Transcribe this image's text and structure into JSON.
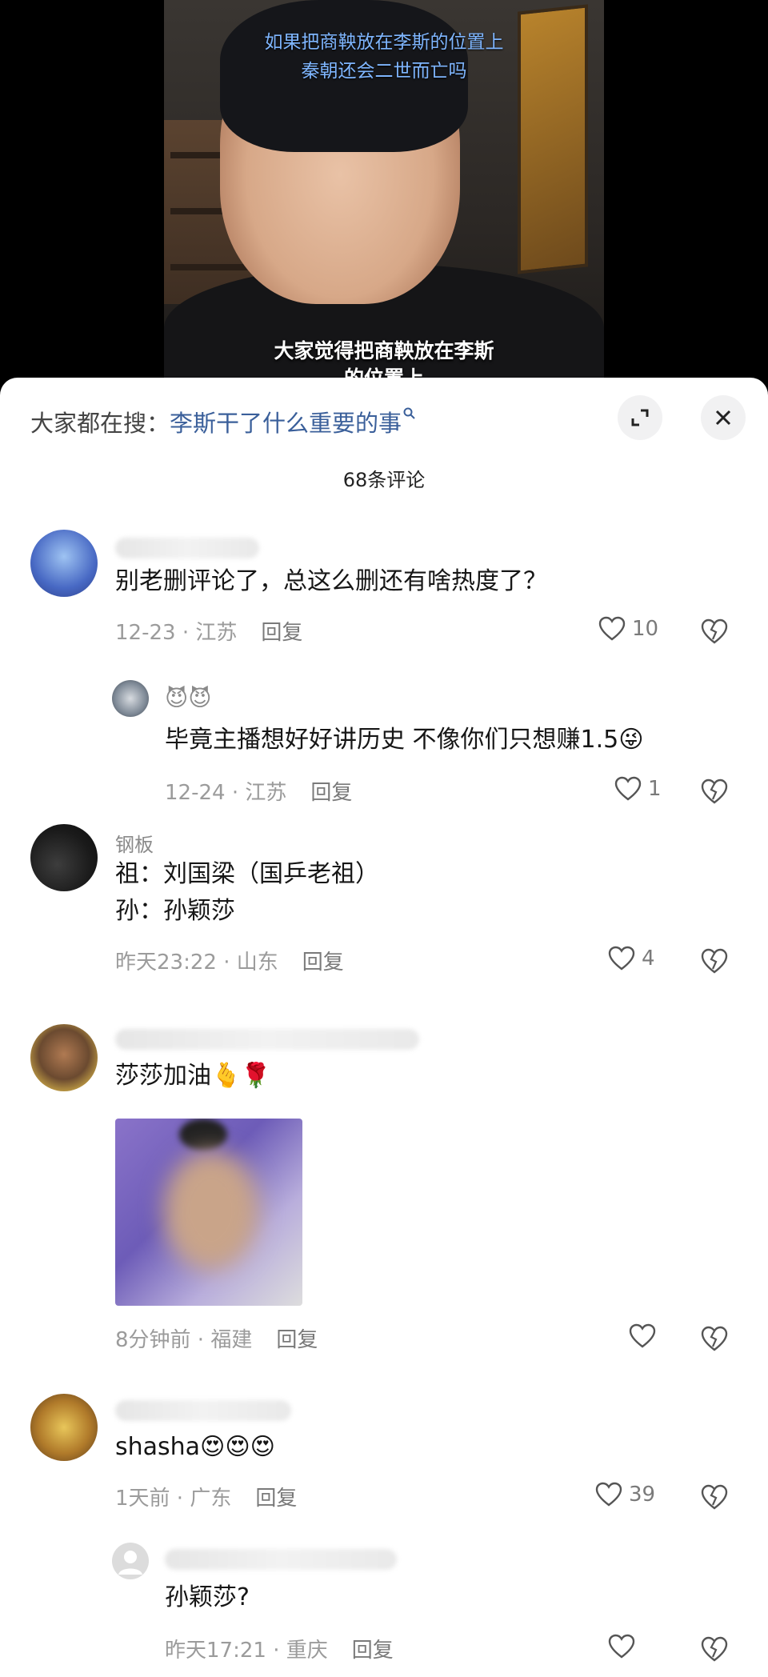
{
  "video": {
    "subtitle_top_line1": "如果把商鞅放在李斯的位置上",
    "subtitle_top_line2": "秦朝还会二世而亡吗",
    "subtitle_bottom_line1": "大家觉得把商鞅放在李斯",
    "subtitle_bottom_line2": "的位置上"
  },
  "sheet": {
    "search_prefix": "大家都在搜：",
    "search_query": "李斯干了什么重要的事",
    "expand_icon": "expand-icon",
    "close_icon": "close-icon",
    "comment_count": "68条评论"
  },
  "comments": [
    {
      "text": "别老删评论了，总这么删还有啥热度了？",
      "time": "12-23 · 江苏",
      "reply": "回复",
      "likes": "10"
    },
    {
      "username_emoji": "😈😈",
      "text": "毕竟主播想好好讲历史 不像你们只想赚1.5😜",
      "time": "12-24 · 江苏",
      "reply": "回复",
      "likes": "1"
    },
    {
      "username": "钢板",
      "text_line1": "祖：刘国梁（国乒老祖）",
      "text_line2": "孙：孙颖莎",
      "time": "昨天23:22 · 山东",
      "reply": "回复",
      "likes": "4"
    },
    {
      "text": "莎莎加油🫰🌹",
      "time": "8分钟前 · 福建",
      "reply": "回复",
      "likes": ""
    },
    {
      "text": "shasha😍😍😍",
      "time": "1天前 · 广东",
      "reply": "回复",
      "likes": "39"
    },
    {
      "text": "孙颖莎?",
      "time": "昨天17:21 · 重庆",
      "reply": "回复",
      "likes": ""
    }
  ]
}
